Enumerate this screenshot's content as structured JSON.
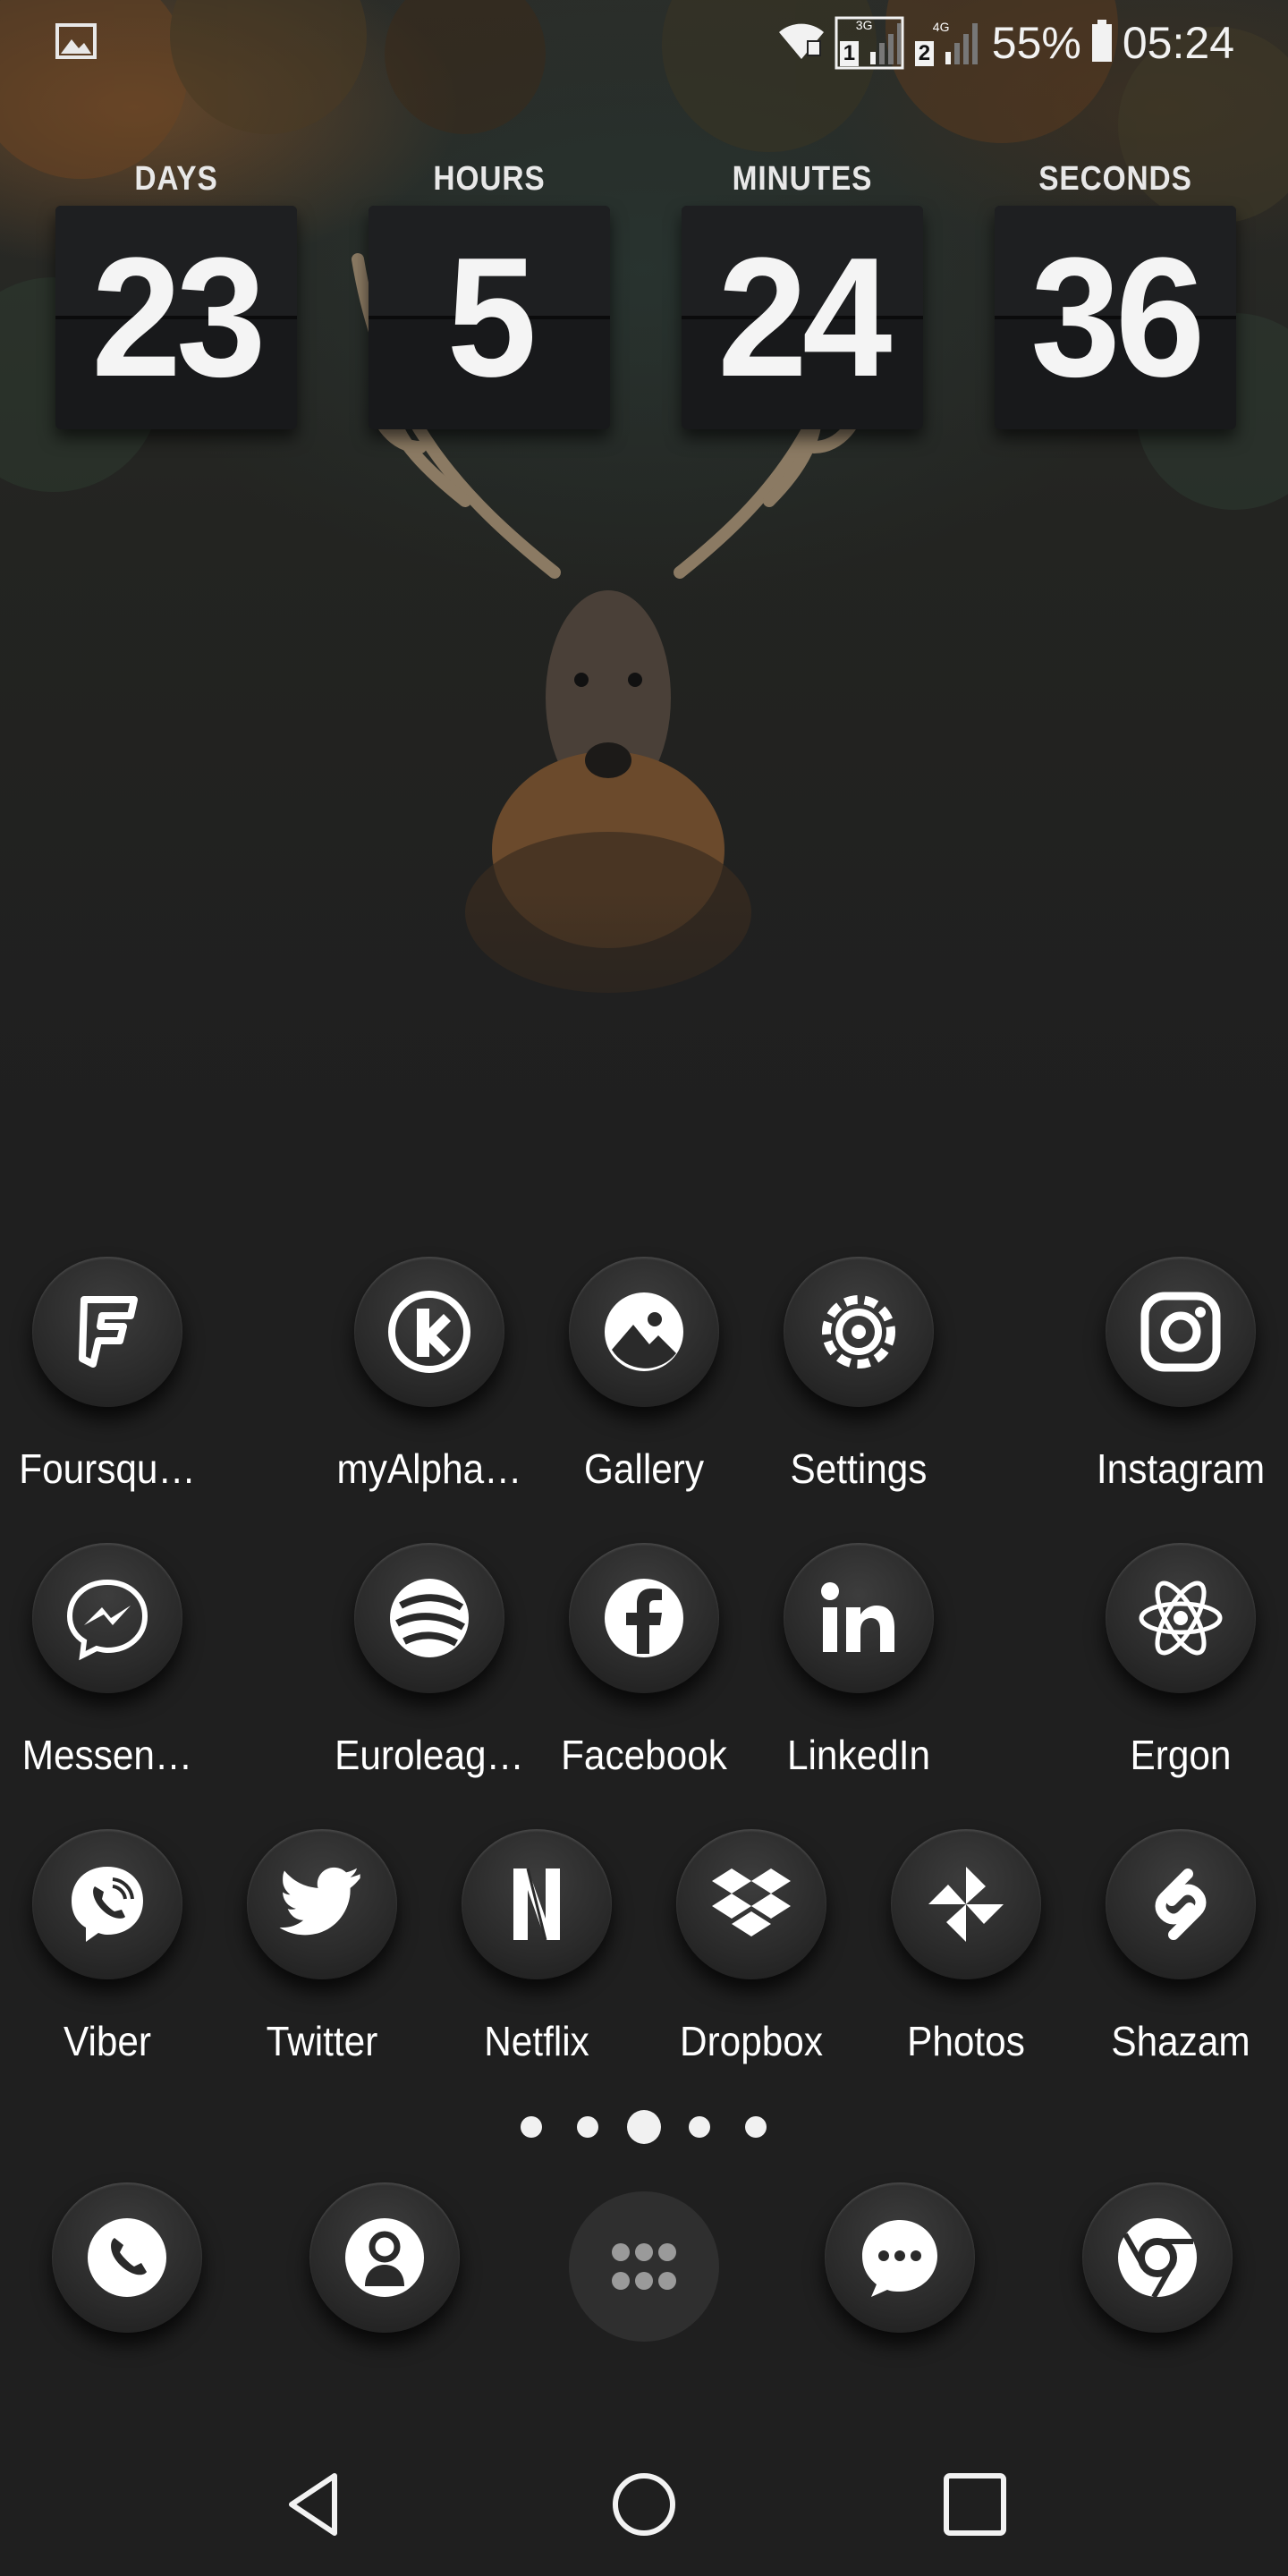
{
  "status_bar": {
    "battery": "55%",
    "time": "05:24",
    "net1": "3G",
    "net2": "4G",
    "sim1": "1",
    "sim2": "2",
    "icons": [
      "gallery-notification-icon",
      "wifi-icon",
      "signal-sim1-icon",
      "signal-sim2-icon",
      "battery-icon"
    ]
  },
  "countdown": {
    "units": [
      {
        "label": "DAYS",
        "value": "23"
      },
      {
        "label": "HOURS",
        "value": "5"
      },
      {
        "label": "MINUTES",
        "value": "24"
      },
      {
        "label": "SECONDS",
        "value": "36"
      }
    ]
  },
  "apps": {
    "rows": [
      [
        {
          "label": "Foursqu…",
          "icon": "foursquare-icon"
        },
        {
          "label": "myAlpha…",
          "icon": "alpha-bank-icon"
        },
        {
          "label": "Gallery",
          "icon": "gallery-icon"
        },
        {
          "label": "Settings",
          "icon": "settings-gear-icon"
        },
        {
          "label": "Instagram",
          "icon": "instagram-icon"
        }
      ],
      [
        {
          "label": "Messen…",
          "icon": "messenger-icon"
        },
        {
          "label": "Euroleag…",
          "icon": "euroleague-icon"
        },
        {
          "label": "Facebook",
          "icon": "facebook-icon"
        },
        {
          "label": "LinkedIn",
          "icon": "linkedin-icon"
        },
        {
          "label": "Ergon",
          "icon": "atom-icon"
        }
      ],
      [
        {
          "label": "Viber",
          "icon": "viber-icon"
        },
        {
          "label": "Twitter",
          "icon": "twitter-icon"
        },
        {
          "label": "Netflix",
          "icon": "netflix-icon"
        },
        {
          "label": "Dropbox",
          "icon": "dropbox-icon"
        },
        {
          "label": "Photos",
          "icon": "pinwheel-photos-icon"
        },
        {
          "label": "Shazam",
          "icon": "shazam-icon"
        }
      ]
    ]
  },
  "pager": {
    "count": 5,
    "active_index": 2
  },
  "dock": {
    "items": [
      "phone-icon",
      "contacts-icon",
      "app-drawer-icon",
      "messages-icon",
      "chrome-icon"
    ]
  },
  "navbar": {
    "buttons": [
      "back-icon",
      "home-icon",
      "recents-icon"
    ]
  }
}
